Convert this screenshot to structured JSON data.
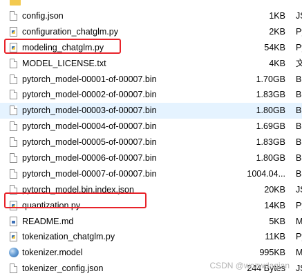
{
  "files": [
    {
      "name": "..",
      "size": "",
      "type": "",
      "icon": "folder-icon"
    },
    {
      "name": "config.json",
      "size": "1KB",
      "type": "JS",
      "icon": "document-icon"
    },
    {
      "name": "configuration_chatglm.py",
      "size": "2KB",
      "type": "Py",
      "icon": "python-file-icon"
    },
    {
      "name": "modeling_chatglm.py",
      "size": "54KB",
      "type": "Py",
      "icon": "python-file-icon"
    },
    {
      "name": "MODEL_LICENSE.txt",
      "size": "4KB",
      "type": "文",
      "icon": "document-icon"
    },
    {
      "name": "pytorch_model-00001-of-00007.bin",
      "size": "1.70GB",
      "type": "B",
      "icon": "document-icon"
    },
    {
      "name": "pytorch_model-00002-of-00007.bin",
      "size": "1.83GB",
      "type": "B",
      "icon": "document-icon"
    },
    {
      "name": "pytorch_model-00003-of-00007.bin",
      "size": "1.80GB",
      "type": "B",
      "icon": "document-icon"
    },
    {
      "name": "pytorch_model-00004-of-00007.bin",
      "size": "1.69GB",
      "type": "B",
      "icon": "document-icon"
    },
    {
      "name": "pytorch_model-00005-of-00007.bin",
      "size": "1.83GB",
      "type": "B",
      "icon": "document-icon"
    },
    {
      "name": "pytorch_model-00006-of-00007.bin",
      "size": "1.80GB",
      "type": "B",
      "icon": "document-icon"
    },
    {
      "name": "pytorch_model-00007-of-00007.bin",
      "size": "1004.04...",
      "type": "B",
      "icon": "document-icon"
    },
    {
      "name": "pytorch_model.bin.index.json",
      "size": "20KB",
      "type": "JS",
      "icon": "document-icon"
    },
    {
      "name": "quantization.py",
      "size": "14KB",
      "type": "Py",
      "icon": "python-file-icon"
    },
    {
      "name": "README.md",
      "size": "5KB",
      "type": "M",
      "icon": "markdown-file-icon"
    },
    {
      "name": "tokenization_chatglm.py",
      "size": "11KB",
      "type": "Py",
      "icon": "python-file-icon"
    },
    {
      "name": "tokenizer.model",
      "size": "995KB",
      "type": "M",
      "icon": "model-file-icon"
    },
    {
      "name": "tokenizer_config.json",
      "size": "244 Bytes",
      "type": "JS",
      "icon": "document-icon"
    }
  ],
  "selected_file": "pytorch_model-00003-of-00007.bin",
  "highlighted_files": [
    "modeling_chatglm.py",
    "tokenization_chatglm.py"
  ],
  "colors": {
    "highlight": "#e8232a",
    "selection": "#e5f3ff"
  },
  "watermark": "CSDN @wozwdaqian"
}
